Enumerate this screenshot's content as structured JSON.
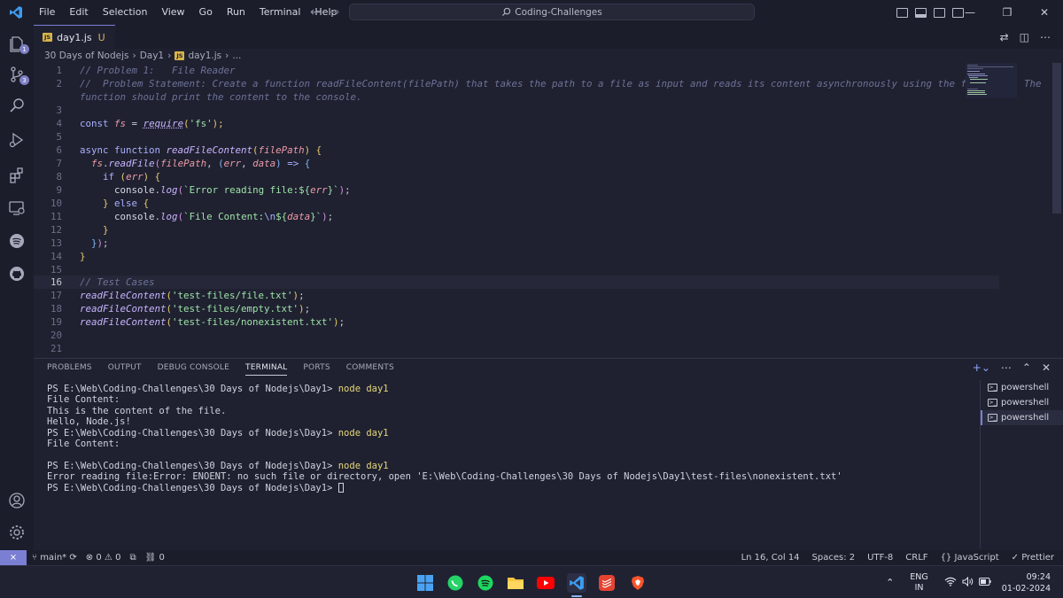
{
  "titlebar": {
    "menu": [
      "File",
      "Edit",
      "Selection",
      "View",
      "Go",
      "Run",
      "Terminal",
      "Help"
    ],
    "search": "Coding-Challenges"
  },
  "tab": {
    "filename": "day1.js",
    "status": "U",
    "badge": "JS"
  },
  "breadcrumb": {
    "folder": "30 Days of Nodejs",
    "sub": "Day1",
    "file": "day1.js",
    "rest": "..."
  },
  "editor": {
    "lines": [
      {
        "n": "1"
      },
      {
        "n": "2"
      },
      {
        "n": ""
      },
      {
        "n": "3"
      },
      {
        "n": "4"
      },
      {
        "n": "5"
      },
      {
        "n": "6"
      },
      {
        "n": "7"
      },
      {
        "n": "8"
      },
      {
        "n": "9"
      },
      {
        "n": "10"
      },
      {
        "n": "11"
      },
      {
        "n": "12"
      },
      {
        "n": "13"
      },
      {
        "n": "14"
      },
      {
        "n": "15"
      },
      {
        "n": "16"
      },
      {
        "n": "17"
      },
      {
        "n": "18"
      },
      {
        "n": "19"
      },
      {
        "n": "20"
      },
      {
        "n": "21"
      }
    ],
    "code": {
      "l1": "// Problem 1:   File Reader",
      "l2a": "//  Problem Statement: Create a function readFileContent(filePath) that takes the path to a file as input and reads its content asynchronously using the fs module. The",
      "l2b": "function should print the content to the console.",
      "l4_kw": "const",
      "l4_var": "fs",
      "l4_eq": " = ",
      "l4_fn": "require",
      "l4_str": "'fs'",
      "l4_end": ");",
      "l6_kw": "async function",
      "l6_fn": "readFileContent",
      "l6_p": "filePath",
      "l7_obj": "fs",
      "l7_fn": "readFile",
      "l7_p": "filePath",
      "l7_err": "err",
      "l7_data": "data",
      "l8_kw": "if",
      "l8_err": "err",
      "l9_obj": "console",
      "l9_fn": "log",
      "l9_str": "`Error reading file:${",
      "l9_var": "err",
      "l9_str2": "}`",
      "l10_kw": "else",
      "l11_str": "`File Content:",
      "l11_esc": "\\n",
      "l11_str2": "${",
      "l11_var": "data",
      "l11_str3": "}`",
      "l16": "// Test Cases",
      "l17_fn": "readFileContent",
      "l17_str": "'test-files/file.txt'",
      "l18_str": "'test-files/empty.txt'",
      "l19_str": "'test-files/nonexistent.txt'"
    }
  },
  "panel": {
    "tabs": [
      "PROBLEMS",
      "OUTPUT",
      "DEBUG CONSOLE",
      "TERMINAL",
      "PORTS",
      "COMMENTS"
    ],
    "active_tab": "TERMINAL",
    "terminal_lines": [
      {
        "prompt": "PS E:\\Web\\Coding-Challenges\\30 Days of Nodejs\\Day1> ",
        "cmd": "node day1"
      },
      {
        "text": "File Content:"
      },
      {
        "text": "This is the content of the file."
      },
      {
        "text": "Hello, Node.js!"
      },
      {
        "prompt": "PS E:\\Web\\Coding-Challenges\\30 Days of Nodejs\\Day1> ",
        "cmd": "node day1"
      },
      {
        "text": "File Content:"
      },
      {
        "text": ""
      },
      {
        "prompt": "PS E:\\Web\\Coding-Challenges\\30 Days of Nodejs\\Day1> ",
        "cmd": "node day1"
      },
      {
        "text": "Error reading file:Error: ENOENT: no such file or directory, open 'E:\\Web\\Coding-Challenges\\30 Days of Nodejs\\Day1\\test-files\\nonexistent.txt'"
      },
      {
        "prompt": "PS E:\\Web\\Coding-Challenges\\30 Days of Nodejs\\Day1> ",
        "cmd": ""
      }
    ],
    "terminals": [
      "powershell",
      "powershell",
      "powershell"
    ]
  },
  "statusbar": {
    "branch": "main*",
    "errors": "0",
    "warnings": "0",
    "ports": "0",
    "position": "Ln 16, Col 14",
    "spaces": "Spaces: 2",
    "encoding": "UTF-8",
    "eol": "CRLF",
    "language": "JavaScript",
    "formatter": "Prettier"
  },
  "taskbar": {
    "lang_top": "ENG",
    "lang_bottom": "IN",
    "time": "09:24",
    "date": "01-02-2024"
  },
  "colors": {
    "accent": "#7b7fd4",
    "background": "#1f2130",
    "sidebar": "#1b1d2a"
  }
}
